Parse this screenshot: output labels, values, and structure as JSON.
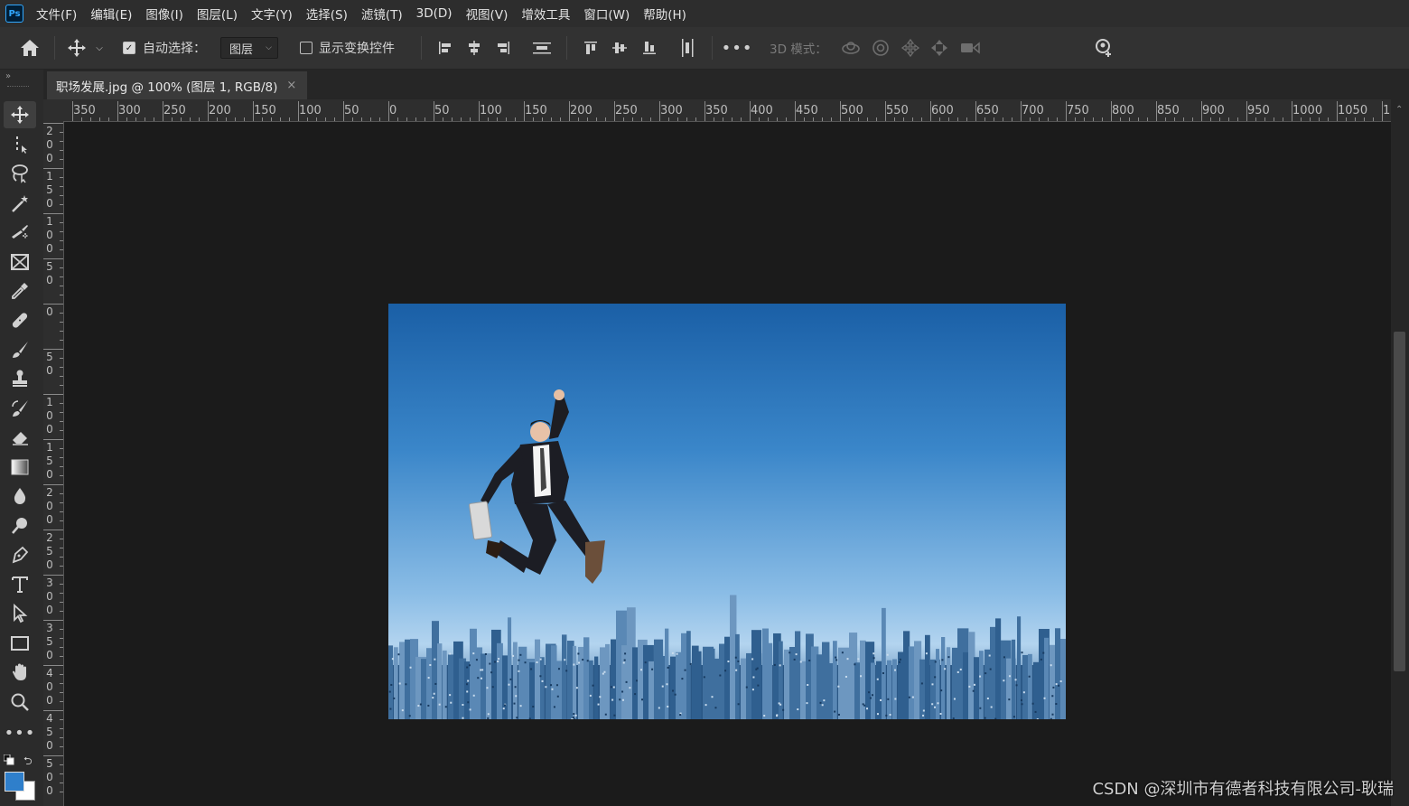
{
  "app": {
    "logo_text": "Ps"
  },
  "menubar": {
    "items": [
      "文件(F)",
      "编辑(E)",
      "图像(I)",
      "图层(L)",
      "文字(Y)",
      "选择(S)",
      "滤镜(T)",
      "3D(D)",
      "视图(V)",
      "增效工具",
      "窗口(W)",
      "帮助(H)"
    ]
  },
  "options": {
    "auto_select_label": "自动选择：",
    "auto_select_checked": true,
    "auto_select_target": "图层",
    "show_transform_label": "显示变换控件",
    "show_transform_checked": false,
    "mode_3d_label": "3D 模式："
  },
  "document": {
    "tab_title": "职场发展.jpg @ 100% (图层 1, RGB/8)",
    "zoom": "100%",
    "foreground_color": "#2f7fcb",
    "background_color": "#ffffff"
  },
  "rulers": {
    "top_labels": [
      "350",
      "300",
      "250",
      "200",
      "150",
      "100",
      "50",
      "0",
      "50",
      "100",
      "150",
      "200",
      "250",
      "300",
      "350",
      "400",
      "450",
      "500",
      "550",
      "600",
      "650",
      "700",
      "750",
      "800",
      "850",
      "900",
      "950",
      "1000",
      "1050",
      "1"
    ],
    "left_labels": [
      "200",
      "150",
      "100",
      "50",
      "0",
      "50",
      "100",
      "150",
      "200",
      "250",
      "300",
      "350",
      "400",
      "450",
      "500"
    ]
  },
  "watermark": "CSDN @深圳市有德者科技有限公司-耿瑞"
}
